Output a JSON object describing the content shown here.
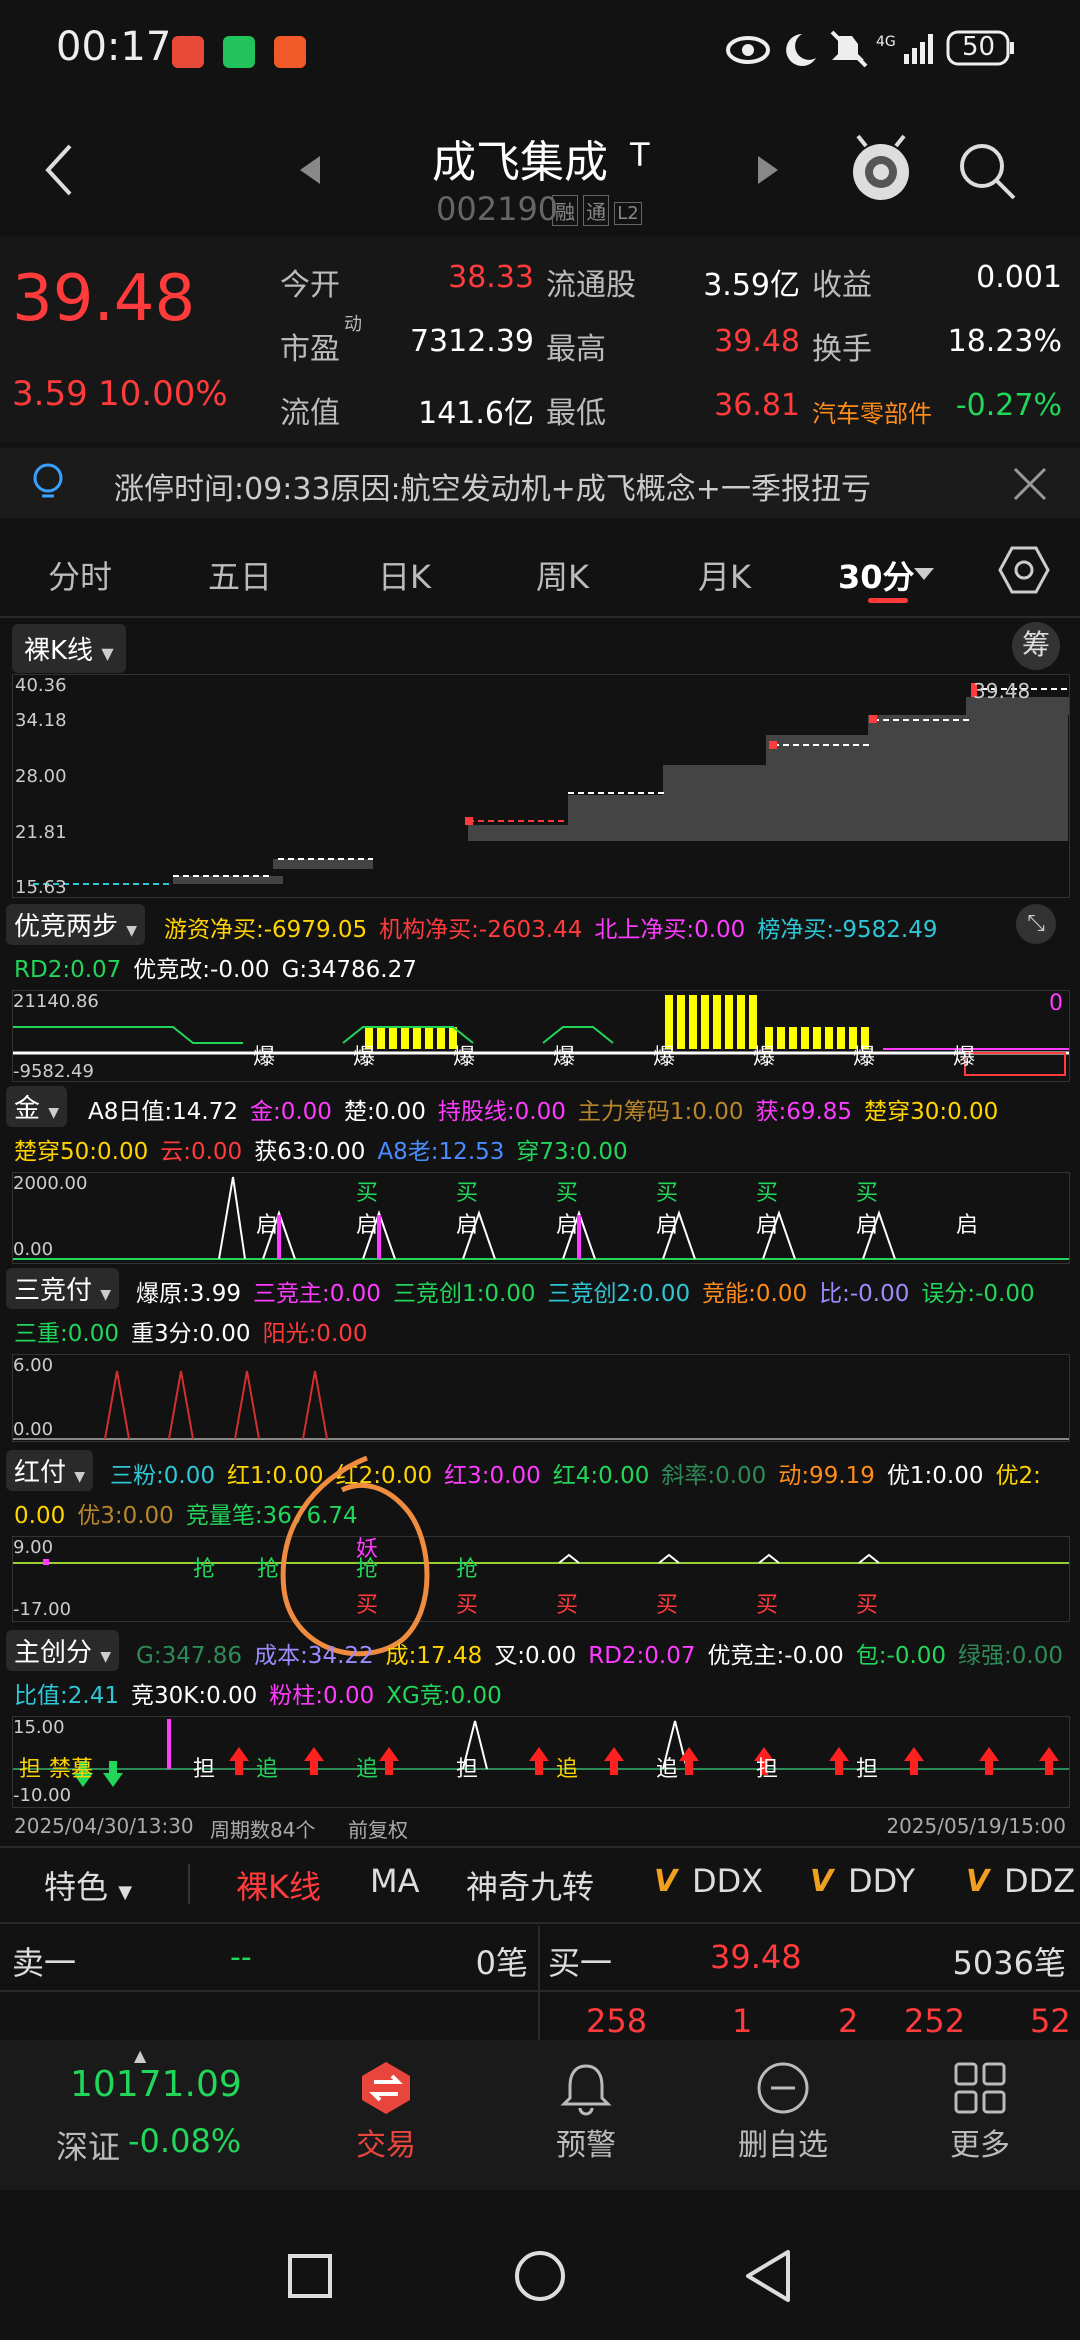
{
  "status_bar": {
    "time": "00:17",
    "network": "4G",
    "battery": "50"
  },
  "header": {
    "title": "成飞集成",
    "title_tag": "T",
    "code": "002190",
    "badges": [
      "融",
      "通",
      "L2"
    ]
  },
  "quote": {
    "price": "39.48",
    "change": "3.59",
    "change_pct": "10.00%",
    "fields": [
      {
        "label": "今开",
        "value": "38.33",
        "color": "#ff3b3b"
      },
      {
        "label": "流通股",
        "value": "3.59亿",
        "color": "#ffffff"
      },
      {
        "label": "收益",
        "value": "0.001",
        "color": "#ffffff"
      },
      {
        "label": "市盈",
        "sup": "动",
        "value": "7312.39",
        "color": "#ffffff"
      },
      {
        "label": "最高",
        "value": "39.48",
        "color": "#ff3b3b"
      },
      {
        "label": "换手",
        "value": "18.23%",
        "color": "#ffffff"
      },
      {
        "label": "流值",
        "value": "141.6亿",
        "color": "#ffffff"
      },
      {
        "label": "最低",
        "value": "36.81",
        "color": "#ff3b3b"
      },
      {
        "label": "汽车零部件",
        "value": "-0.27%",
        "color": "#22d65a"
      }
    ]
  },
  "notice": "涨停时间:09:33原因:航空发动机+成飞概念+一季报扭亏",
  "tabs": [
    "分时",
    "五日",
    "日K",
    "周K",
    "月K",
    "30分"
  ],
  "active_tab": "30分",
  "kline": {
    "selector": "裸K线",
    "chip_btn": "筹",
    "ticks": [
      "40.36",
      "34.18",
      "28.00",
      "21.81",
      "15.63"
    ],
    "last_label": "39.48"
  },
  "ind1": {
    "selector": "优竞两步",
    "line1": [
      {
        "t": "游资净买:-6979.05",
        "c": "#ffd400"
      },
      {
        "t": "机构净买:-2603.44",
        "c": "#ff3b3b"
      },
      {
        "t": "北上净买:0.00",
        "c": "#ff3bff"
      },
      {
        "t": "榜净买:-9582.49",
        "c": "#2fc6d6"
      }
    ],
    "line2": [
      {
        "t": "RD2:0.07",
        "c": "#22d65a"
      },
      {
        "t": "优竞改:-0.00",
        "c": "#ffffff"
      },
      {
        "t": "G:34786.27",
        "c": "#ffffff"
      }
    ],
    "ticks": [
      "21140.86",
      "-9582.49"
    ],
    "right_val": "0",
    "marker": "爆"
  },
  "ind2": {
    "selector": "金",
    "line1": [
      {
        "t": "A8日值:14.72",
        "c": "#ffffff"
      },
      {
        "t": "金:0.00",
        "c": "#ff3bff"
      },
      {
        "t": "楚:0.00",
        "c": "#ffffff"
      },
      {
        "t": "持股线:0.00",
        "c": "#ff3bff"
      },
      {
        "t": "主力筹码1:0.00",
        "c": "#b8862b"
      },
      {
        "t": "获:69.85",
        "c": "#ff3bff"
      },
      {
        "t": "楚穿30:0.00",
        "c": "#ffd400"
      }
    ],
    "line2": [
      {
        "t": "楚穿50:0.00",
        "c": "#ffd400"
      },
      {
        "t": "云:0.00",
        "c": "#ff3b3b"
      },
      {
        "t": "获63:0.00",
        "c": "#ffffff"
      },
      {
        "t": "A8老:12.53",
        "c": "#4a8cff"
      },
      {
        "t": "穿73:0.00",
        "c": "#22d65a"
      }
    ],
    "ticks": [
      "2000.00",
      "0.00"
    ],
    "buy": "买",
    "start": "启"
  },
  "ind3": {
    "selector": "三竞付",
    "line1": [
      {
        "t": "爆原:3.99",
        "c": "#ffffff"
      },
      {
        "t": "三竞主:0.00",
        "c": "#ff3bff"
      },
      {
        "t": "三竞创1:0.00",
        "c": "#22d65a"
      },
      {
        "t": "三竞创2:0.00",
        "c": "#2fc6d6"
      },
      {
        "t": "竞能:0.00",
        "c": "#ff8c1a"
      },
      {
        "t": "比:-0.00",
        "c": "#9a8cff"
      },
      {
        "t": "误分:-0.00",
        "c": "#22d65a"
      }
    ],
    "line2": [
      {
        "t": "三重:0.00",
        "c": "#22d65a"
      },
      {
        "t": "重3分:0.00",
        "c": "#ffffff"
      },
      {
        "t": "阳光:0.00",
        "c": "#ff3b3b"
      }
    ],
    "ticks": [
      "6.00",
      "0.00"
    ]
  },
  "ind4": {
    "selector": "红付",
    "line1": [
      {
        "t": "三粉:0.00",
        "c": "#2fc6d6"
      },
      {
        "t": "红1:0.00",
        "c": "#ffd400"
      },
      {
        "t": "红2:0.00",
        "c": "#ffd400"
      },
      {
        "t": "红3:0.00",
        "c": "#ff3bff"
      },
      {
        "t": "红4:0.00",
        "c": "#22d65a"
      },
      {
        "t": "斜率:0.00",
        "c": "#2e8b57"
      },
      {
        "t": "动:99.19",
        "c": "#ff8c1a"
      },
      {
        "t": "优1:0.00",
        "c": "#ffffff"
      },
      {
        "t": "优2:",
        "c": "#ffd400"
      }
    ],
    "line2": [
      {
        "t": "0.00",
        "c": "#ffd400"
      },
      {
        "t": "优3:0.00",
        "c": "#b8862b"
      },
      {
        "t": "竞量笔:3676.74",
        "c": "#22d65a"
      }
    ],
    "ticks": [
      "9.00",
      "-17.00"
    ],
    "grab": "抢",
    "buy": "买",
    "demon": "妖"
  },
  "ind5": {
    "selector": "主创分",
    "line1": [
      {
        "t": "G:347.86",
        "c": "#2e8b57"
      },
      {
        "t": "成本:34.22",
        "c": "#9a8cff"
      },
      {
        "t": "成:17.48",
        "c": "#ffd400"
      },
      {
        "t": "叉:0.00",
        "c": "#ffffff"
      },
      {
        "t": "RD2:0.07",
        "c": "#ff3bff"
      },
      {
        "t": "优竞主:-0.00",
        "c": "#ffffff"
      },
      {
        "t": "包:-0.00",
        "c": "#22d65a"
      },
      {
        "t": "绿强:0.00",
        "c": "#2e8b57"
      }
    ],
    "line2": [
      {
        "t": "比值:2.41",
        "c": "#2fc6d6"
      },
      {
        "t": "竞30K:0.00",
        "c": "#ffffff"
      },
      {
        "t": "粉柱:0.00",
        "c": "#ff3bff"
      },
      {
        "t": "XG竞:0.00",
        "c": "#22d65a"
      }
    ],
    "ticks": [
      "15.00",
      "-10.00"
    ],
    "chase": "追",
    "hold": "担",
    "left_tags": [
      "担",
      "禁墓"
    ]
  },
  "footer_info": {
    "start": "2025/04/30/13:30",
    "count": "周期数84个",
    "adj": "前复权",
    "end": "2025/05/19/15:00"
  },
  "feature_bar": {
    "selector": "特色",
    "items": [
      "裸K线",
      "MA",
      "神奇九转",
      "DDX",
      "DDY",
      "DDZ"
    ],
    "v": "V"
  },
  "order_book": {
    "sell_label": "卖一",
    "sell_price": "--",
    "sell_count": "0笔",
    "buy_label": "买一",
    "buy_price": "39.48",
    "buy_count": "5036笔",
    "queue": [
      "258",
      "1",
      "2",
      "252",
      "52"
    ]
  },
  "bottom_nav": {
    "index_value": "10171.09",
    "index_name": "深证",
    "index_change": "-0.08%",
    "items": [
      "交易",
      "预警",
      "删自选",
      "更多"
    ]
  }
}
